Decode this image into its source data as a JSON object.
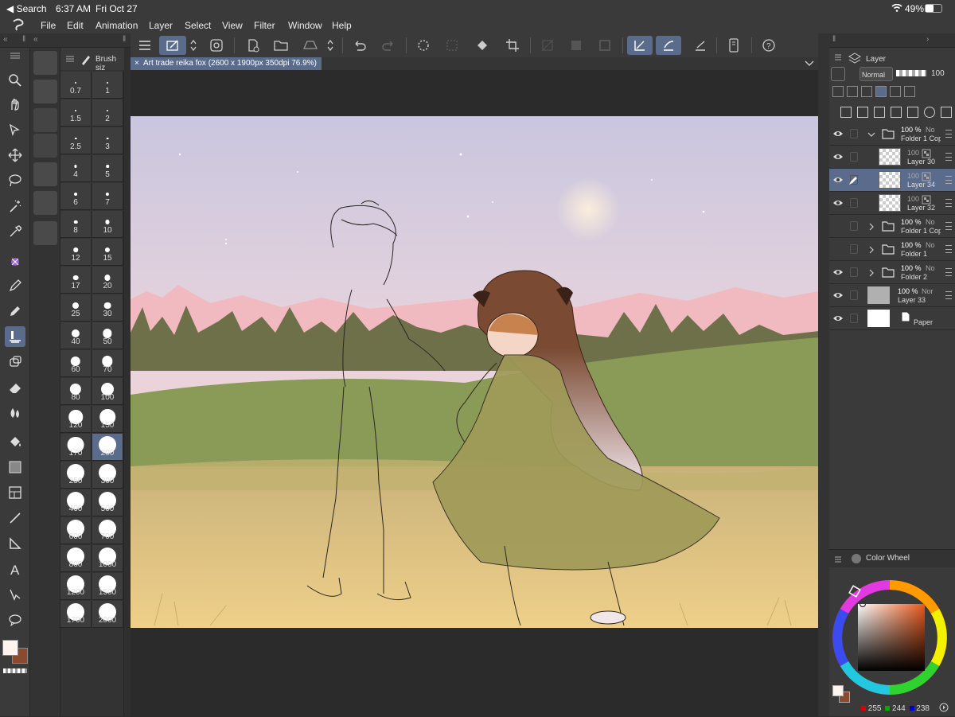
{
  "status_bar": {
    "back": "◀ Search",
    "time": "6:37 AM",
    "date": "Fri Oct 27",
    "battery": "49%"
  },
  "menu": {
    "items": [
      "File",
      "Edit",
      "Animation",
      "Layer",
      "Select",
      "View",
      "Filter",
      "Window",
      "Help"
    ]
  },
  "document_tab": {
    "title": "Art trade reika fox (2600 x 1900px 350dpi 76.9%)",
    "close": "×"
  },
  "brush_panel": {
    "title": "Brush siz",
    "selected": "200",
    "sizes": [
      "0.7",
      "1",
      "1.5",
      "2",
      "2.5",
      "3",
      "4",
      "5",
      "6",
      "7",
      "8",
      "10",
      "12",
      "15",
      "17",
      "20",
      "25",
      "30",
      "40",
      "50",
      "60",
      "70",
      "80",
      "100",
      "120",
      "150",
      "170",
      "200",
      "250",
      "300",
      "400",
      "500",
      "600",
      "700",
      "800",
      "1000",
      "1200",
      "1500",
      "1700",
      "2000"
    ]
  },
  "layer_panel": {
    "title": "Layer",
    "blend_mode": "Normal",
    "opacity": "100",
    "layers": [
      {
        "pct": "100 %",
        "mode": "No",
        "name": "Folder 1 Cop",
        "kind": "folder-open",
        "visible": true,
        "selected": false
      },
      {
        "pct": "100",
        "mode": "",
        "name": "Layer 30",
        "kind": "raster",
        "visible": true,
        "selected": false
      },
      {
        "pct": "100",
        "mode": "",
        "name": "Layer 34",
        "kind": "raster",
        "visible": true,
        "selected": true
      },
      {
        "pct": "100",
        "mode": "",
        "name": "Layer 32",
        "kind": "raster",
        "visible": true,
        "selected": false
      },
      {
        "pct": "100 %",
        "mode": "No",
        "name": "Folder 1 Cop",
        "kind": "folder",
        "visible": false,
        "selected": false
      },
      {
        "pct": "100 %",
        "mode": "No",
        "name": "Folder 1",
        "kind": "folder",
        "visible": false,
        "selected": false
      },
      {
        "pct": "100 %",
        "mode": "No",
        "name": "Folder 2",
        "kind": "folder",
        "visible": true,
        "selected": false
      },
      {
        "pct": "100 %",
        "mode": "Nor",
        "name": "Layer 33",
        "kind": "fill-gray",
        "visible": true,
        "selected": false
      },
      {
        "pct": "",
        "mode": "",
        "name": "Paper",
        "kind": "paper",
        "visible": true,
        "selected": false
      }
    ]
  },
  "color_panel": {
    "title": "Color Wheel",
    "r": "255",
    "g": "244",
    "b": "238"
  },
  "colors": {
    "accent": "#5a6b8c",
    "panel": "#3a3a3a",
    "main_color": "#fff4ee",
    "sub_color": "#8a4a30"
  }
}
